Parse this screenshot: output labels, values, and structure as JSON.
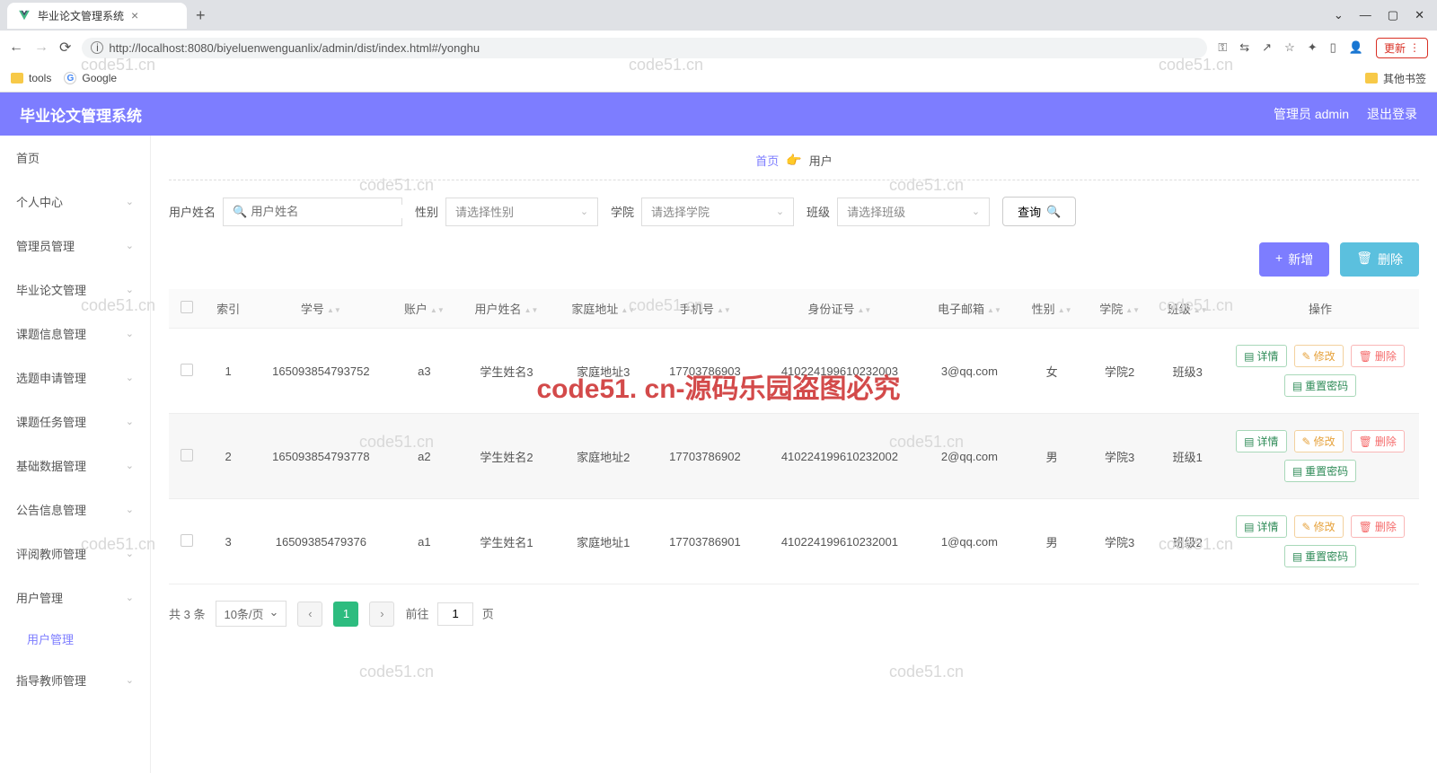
{
  "browser": {
    "tab_title": "毕业论文管理系统",
    "url": "http://localhost:8080/biyeluenwenguanlix/admin/dist/index.html#/yonghu",
    "update_label": "更新",
    "bookmarks": {
      "tools": "tools",
      "google": "Google",
      "other": "其他书签"
    }
  },
  "header": {
    "title": "毕业论文管理系统",
    "user_label": "管理员 admin",
    "logout": "退出登录"
  },
  "sidebar": {
    "home": "首页",
    "personal": "个人中心",
    "admin_mgmt": "管理员管理",
    "thesis_mgmt": "毕业论文管理",
    "topic_info": "课题信息管理",
    "apply_mgmt": "选题申请管理",
    "task_mgmt": "课题任务管理",
    "base_data": "基础数据管理",
    "notice_mgmt": "公告信息管理",
    "review_teacher": "评阅教师管理",
    "user_mgmt": "用户管理",
    "user_mgmt_sub": "用户管理",
    "guide_teacher": "指导教师管理"
  },
  "breadcrumb": {
    "home": "首页",
    "current": "用户"
  },
  "filters": {
    "name_label": "用户姓名",
    "name_placeholder": "用户姓名",
    "gender_label": "性别",
    "gender_placeholder": "请选择性别",
    "college_label": "学院",
    "college_placeholder": "请选择学院",
    "class_label": "班级",
    "class_placeholder": "请选择班级",
    "query_btn": "查询"
  },
  "actions": {
    "add": "新增",
    "delete": "删除"
  },
  "table": {
    "headers": {
      "index": "索引",
      "stuno": "学号",
      "account": "账户",
      "username": "用户姓名",
      "address": "家庭地址",
      "phone": "手机号",
      "idcard": "身份证号",
      "email": "电子邮箱",
      "gender": "性别",
      "college": "学院",
      "class": "班级",
      "ops": "操作"
    },
    "op_labels": {
      "detail": "详情",
      "edit": "修改",
      "delete": "删除",
      "reset": "重置密码"
    },
    "rows": [
      {
        "idx": "1",
        "stuno": "165093854793752",
        "account": "a3",
        "username": "学生姓名3",
        "address": "家庭地址3",
        "phone": "17703786903",
        "idcard": "410224199610232003",
        "email": "3@qq.com",
        "gender": "女",
        "college": "学院2",
        "class": "班级3"
      },
      {
        "idx": "2",
        "stuno": "165093854793778",
        "account": "a2",
        "username": "学生姓名2",
        "address": "家庭地址2",
        "phone": "17703786902",
        "idcard": "410224199610232002",
        "email": "2@qq.com",
        "gender": "男",
        "college": "学院3",
        "class": "班级1"
      },
      {
        "idx": "3",
        "stuno": "16509385479376",
        "account": "a1",
        "username": "学生姓名1",
        "address": "家庭地址1",
        "phone": "17703786901",
        "idcard": "410224199610232001",
        "email": "1@qq.com",
        "gender": "男",
        "college": "学院3",
        "class": "班级2"
      }
    ]
  },
  "pagination": {
    "total": "共 3 条",
    "page_size": "10条/页",
    "current_page": "1",
    "goto_pre": "前往",
    "goto_post": "页",
    "jump_value": "1"
  },
  "watermarks": {
    "wm": "code51.cn",
    "center": "code51. cn-源码乐园盗图必究"
  }
}
